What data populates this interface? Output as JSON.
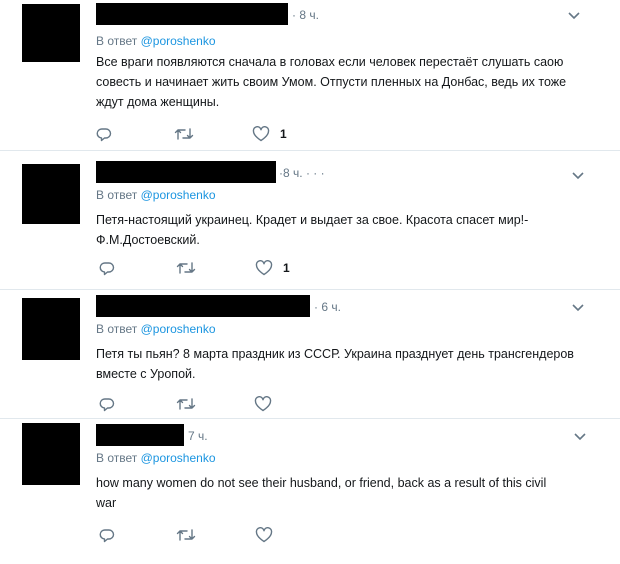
{
  "tweets": [
    {
      "time": "8 ч.",
      "reply_prefix": "В ответ",
      "reply_handle": "@poroshenko",
      "text": "Все враги появляются сначала в головах если человек перестаёт слушать саою совесть и начинает жить своим Умом. Отпусти пленных на Донбас, ведь их тоже ждут дома женщины.",
      "likes": "1"
    },
    {
      "time": "8 ч.",
      "more": "· · ·",
      "reply_prefix": "В ответ",
      "reply_handle": "@poroshenko",
      "text": "Петя-настоящий украинец. Крадет и выдает за свое. Красота спасет мир!- Ф.М.Достоевский.",
      "likes": "1"
    },
    {
      "time": "6 ч.",
      "reply_prefix": "В ответ",
      "reply_handle": "@poroshenko",
      "text": "Петя ты пьян? 8 марта праздник из СССР. Украина празднует день трансгендеров вместе с Уропой.",
      "likes": ""
    },
    {
      "time": "7 ч.",
      "reply_prefix": "В ответ",
      "reply_handle": "@poroshenko",
      "text": "how many women do not see their husband, or friend, back as a result of this civil war",
      "likes": ""
    }
  ],
  "icons": {
    "reply": "reply-icon",
    "retweet": "retweet-icon",
    "like": "heart-icon",
    "menu": "chevron-down-icon"
  },
  "colors": {
    "text": "#14171a",
    "secondary": "#657786",
    "link": "#1b95e0",
    "divider": "#e1e8ed",
    "redaction": "#000000"
  }
}
